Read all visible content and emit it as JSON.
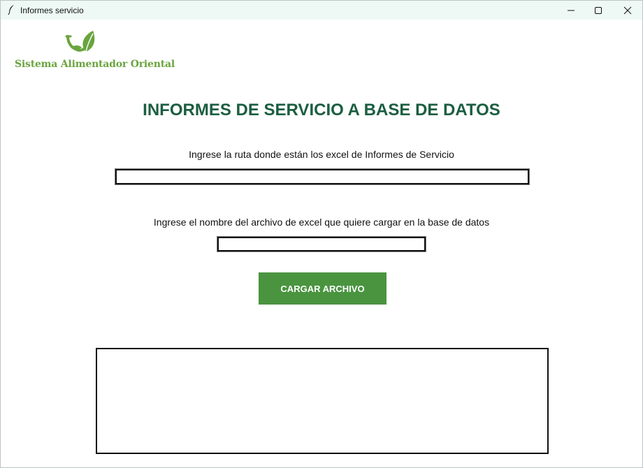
{
  "window": {
    "title": "Informes servicio",
    "icon": "feather-icon",
    "controls": [
      "minimize-icon",
      "maximize-icon",
      "close-icon"
    ]
  },
  "logo": {
    "text": "Sistema Alimentador Oriental",
    "color": "#6aa43f"
  },
  "main": {
    "heading": "INFORMES DE SERVICIO A BASE DE DATOS",
    "heading_color": "#1b5e40",
    "ruta_label": "Ingrese la ruta donde están los excel de Informes de Servicio",
    "ruta_value": "",
    "nombre_label": "Ingrese el nombre del archivo de excel que quiere cargar en la base de datos",
    "nombre_value": "",
    "cargar_button": "CARGAR ARCHIVO",
    "button_color": "#4a9440",
    "output_text": ""
  }
}
